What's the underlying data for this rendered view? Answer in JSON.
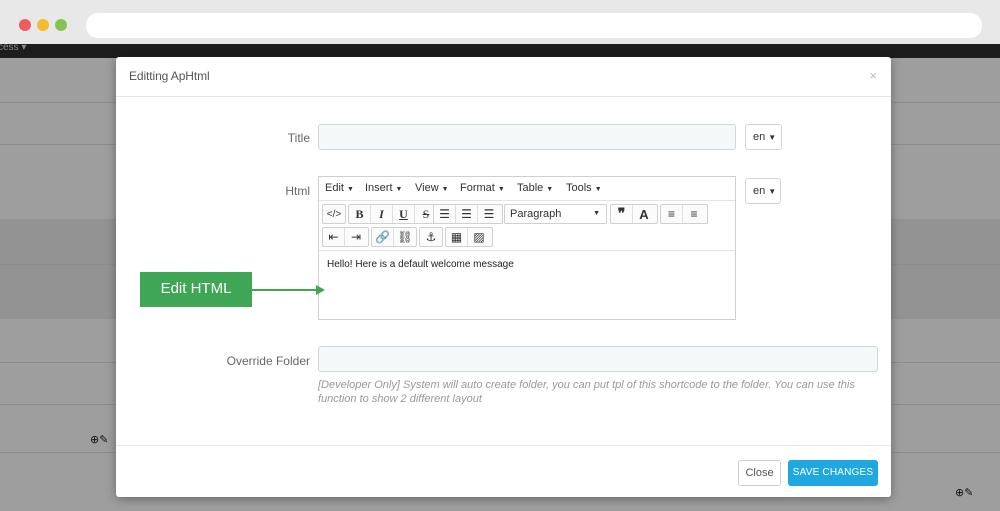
{
  "modal": {
    "title": "Editting ApHtml",
    "close_glyph": "×"
  },
  "form": {
    "title_label": "Title",
    "title_value": "",
    "title_lang": "en",
    "html_label": "Html",
    "html_lang": "en",
    "override_label": "Override Folder",
    "override_value": "",
    "help_text": "[Developer Only] System will auto create folder, you can put tpl of this shortcode to the folder. You can use this function to show 2 different layout"
  },
  "editor": {
    "menus": [
      "Edit",
      "Insert",
      "View",
      "Format",
      "Table",
      "Tools"
    ],
    "format_select": "Paragraph",
    "content": "Hello! Here is a default welcome message"
  },
  "footer": {
    "close_label": "Close",
    "save_label": "SAVE CHANGES"
  },
  "annotation": {
    "label": "Edit HTML"
  },
  "background": {
    "topbar_text": "cess ▾"
  },
  "colors": {
    "accent": "#1fa8e0",
    "annotation": "#3ea655"
  }
}
